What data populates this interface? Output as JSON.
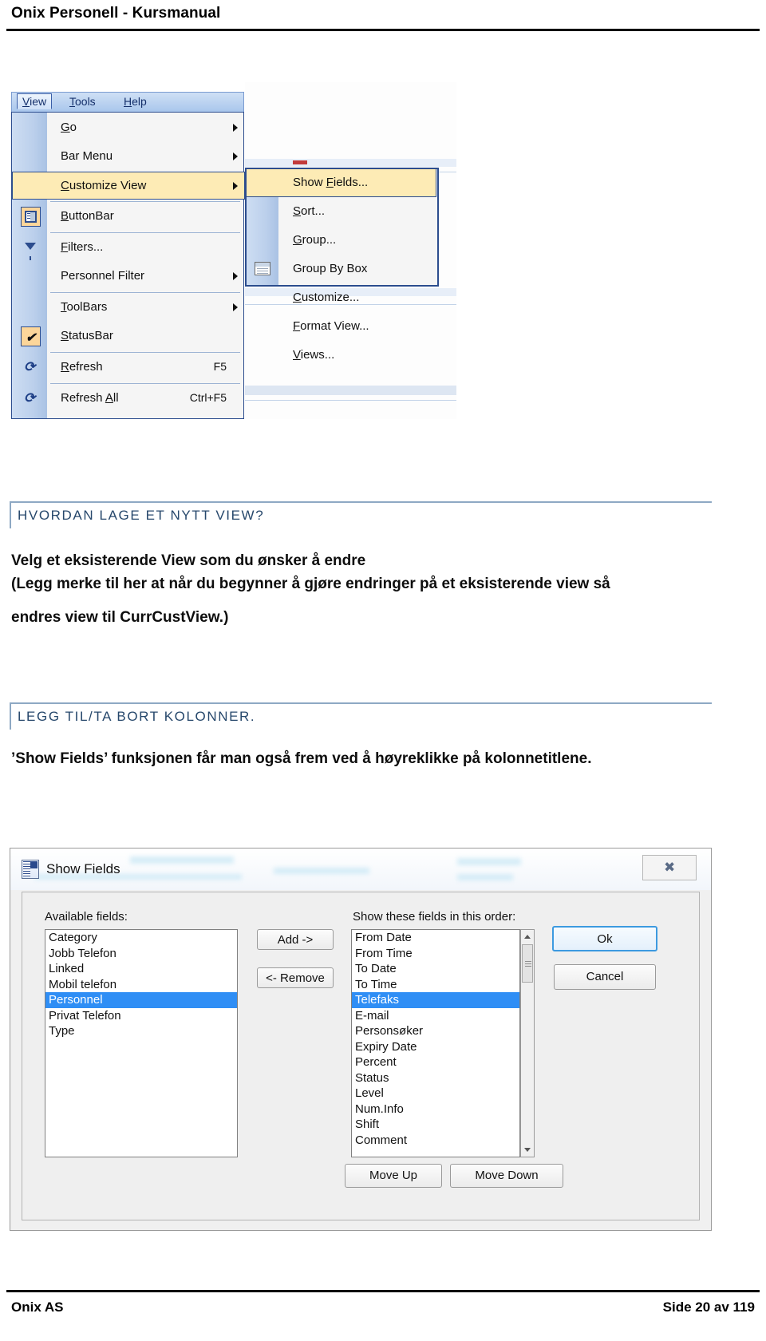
{
  "header": {
    "title": "Onix Personell - Kursmanual"
  },
  "footer": {
    "left": "Onix AS",
    "right": "Side 20 av 119"
  },
  "menu_screenshot": {
    "menubar": [
      {
        "label": "View",
        "accel": "V",
        "active": true
      },
      {
        "label": "Tools",
        "accel": "T",
        "active": false
      },
      {
        "label": "Help",
        "accel": "H",
        "active": false
      }
    ],
    "view_menu": [
      {
        "label": "Go",
        "accel": "G",
        "shortcut": "",
        "submenu": true,
        "highlighted": false,
        "icon": "",
        "separator_after": false
      },
      {
        "label": "Bar Menu",
        "accel": "",
        "shortcut": "",
        "submenu": true,
        "highlighted": false,
        "icon": "",
        "separator_after": false
      },
      {
        "label": "Customize View",
        "accel": "C",
        "shortcut": "",
        "submenu": true,
        "highlighted": true,
        "icon": "",
        "separator_after": true
      },
      {
        "label": "ButtonBar",
        "accel": "B",
        "shortcut": "",
        "submenu": false,
        "highlighted": false,
        "icon": "buttonbar-icon",
        "separator_after": true
      },
      {
        "label": "Filters...",
        "accel": "F",
        "shortcut": "",
        "submenu": false,
        "highlighted": false,
        "icon": "funnel-icon",
        "separator_after": false
      },
      {
        "label": "Personnel Filter",
        "accel": "",
        "shortcut": "",
        "submenu": true,
        "highlighted": false,
        "icon": "",
        "separator_after": true
      },
      {
        "label": "ToolBars",
        "accel": "T",
        "shortcut": "",
        "submenu": true,
        "highlighted": false,
        "icon": "",
        "separator_after": false
      },
      {
        "label": "StatusBar",
        "accel": "S",
        "shortcut": "",
        "submenu": false,
        "highlighted": false,
        "icon": "checkmark-icon",
        "separator_after": true
      },
      {
        "label": "Refresh",
        "accel": "R",
        "shortcut": "F5",
        "submenu": false,
        "highlighted": false,
        "icon": "refresh-icon",
        "separator_after": true
      },
      {
        "label": "Refresh All",
        "accel": "A",
        "shortcut": "Ctrl+F5",
        "submenu": false,
        "highlighted": false,
        "icon": "refresh-all-icon",
        "separator_after": false
      }
    ],
    "customize_view_submenu": [
      {
        "label": "Show Fields...",
        "accel": "F",
        "highlighted": true,
        "icon": ""
      },
      {
        "label": "Sort...",
        "accel": "S",
        "highlighted": false,
        "icon": ""
      },
      {
        "label": "Group...",
        "accel": "G",
        "highlighted": false,
        "icon": ""
      },
      {
        "label": "Group By Box",
        "accel": "",
        "highlighted": false,
        "icon": "group-by-box-icon"
      },
      {
        "label": "Customize...",
        "accel": "C",
        "highlighted": false,
        "icon": ""
      },
      {
        "label": "Format View...",
        "accel": "F",
        "highlighted": false,
        "icon": ""
      },
      {
        "label": "Views...",
        "accel": "V",
        "highlighted": false,
        "icon": ""
      }
    ]
  },
  "section1": {
    "heading": "HVORDAN LAGE ET NYTT VIEW?",
    "line1": "Velg et eksisterende View som du ønsker å endre",
    "line2": "(Legg merke til her at når du begynner å gjøre endringer på et eksisterende view så",
    "line3": "endres view til CurrCustView.)"
  },
  "section2": {
    "heading": "LEGG TIL/TA BORT KOLONNER.",
    "line1": "’Show Fields’ funksjonen får man også frem ved å høyreklikke på kolonnetitlene."
  },
  "dialog": {
    "title": "Show Fields",
    "close_glyph": "✖",
    "available_label": "Available fields:",
    "order_label": "Show these fields in this order:",
    "available_fields": [
      {
        "label": "Category",
        "selected": false
      },
      {
        "label": "Jobb Telefon",
        "selected": false
      },
      {
        "label": "Linked",
        "selected": false
      },
      {
        "label": "Mobil telefon",
        "selected": false
      },
      {
        "label": "Personnel",
        "selected": true
      },
      {
        "label": "Privat Telefon",
        "selected": false
      },
      {
        "label": "Type",
        "selected": false
      }
    ],
    "order_fields": [
      {
        "label": "From Date",
        "selected": false
      },
      {
        "label": "From Time",
        "selected": false
      },
      {
        "label": "To Date",
        "selected": false
      },
      {
        "label": "To Time",
        "selected": false
      },
      {
        "label": "Telefaks",
        "selected": true
      },
      {
        "label": "E-mail",
        "selected": false
      },
      {
        "label": "Personsøker",
        "selected": false
      },
      {
        "label": "Expiry Date",
        "selected": false
      },
      {
        "label": "Percent",
        "selected": false
      },
      {
        "label": "Status",
        "selected": false
      },
      {
        "label": "Level",
        "selected": false
      },
      {
        "label": "Num.Info",
        "selected": false
      },
      {
        "label": "Shift",
        "selected": false
      },
      {
        "label": "Comment",
        "selected": false
      }
    ],
    "buttons": {
      "add": "Add ->",
      "remove": "<- Remove",
      "ok": "Ok",
      "cancel": "Cancel",
      "move_up": "Move Up",
      "move_down": "Move Down"
    }
  },
  "colors": {
    "accent_heading": "#27486c",
    "menu_highlight": "#fdebb5",
    "menu_border": "#2c4d8e",
    "list_selection": "#2f8ef5"
  }
}
